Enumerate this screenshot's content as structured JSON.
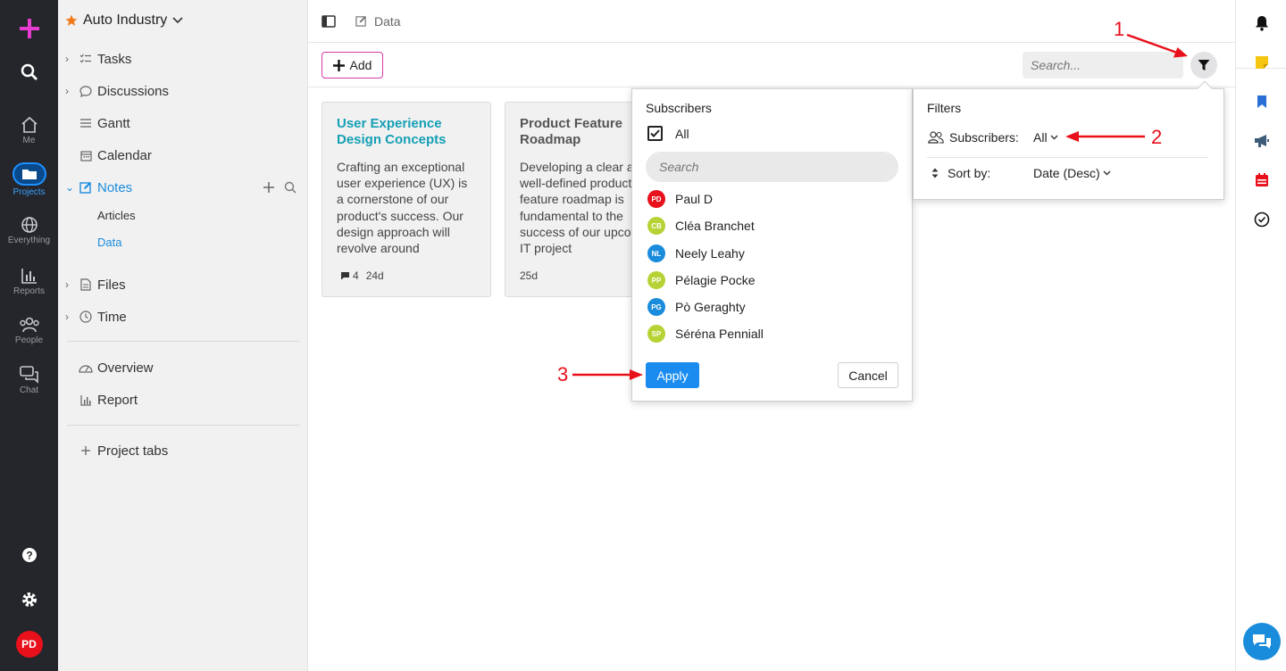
{
  "rail": {
    "items": [
      {
        "label": "Me"
      },
      {
        "label": "Projects"
      },
      {
        "label": "Everything"
      },
      {
        "label": "Reports"
      },
      {
        "label": "People"
      },
      {
        "label": "Chat"
      }
    ],
    "avatar_initials": "PD"
  },
  "sidebar": {
    "project_name": "Auto Industry",
    "items": [
      {
        "label": "Tasks"
      },
      {
        "label": "Discussions"
      },
      {
        "label": "Gantt"
      },
      {
        "label": "Calendar"
      },
      {
        "label": "Notes"
      },
      {
        "label": "Articles"
      },
      {
        "label": "Data"
      },
      {
        "label": "Files"
      },
      {
        "label": "Time"
      },
      {
        "label": "Overview"
      },
      {
        "label": "Report"
      },
      {
        "label": "Project tabs"
      }
    ]
  },
  "topbar": {
    "breadcrumb": "Data"
  },
  "toolbar": {
    "add_label": "Add",
    "search_placeholder": "Search..."
  },
  "cards": [
    {
      "title": "User Experience Design Concepts",
      "excerpt": "Crafting an exceptional user experience (UX) is a cornerstone of our product's success. Our design approach will revolve around",
      "comments": "4",
      "age": "24d"
    },
    {
      "title": "Product Feature Roadmap",
      "excerpt": "Developing a clear and well-defined product feature roadmap is fundamental to the success of our upcoming IT project",
      "age": "25d"
    }
  ],
  "subscribers_popup": {
    "title": "Subscribers",
    "all_label": "All",
    "search_placeholder": "Search",
    "users": [
      {
        "initials": "PD",
        "name": "Paul D",
        "color": "#e8101a"
      },
      {
        "initials": "CB",
        "name": "Cléa Branchet",
        "color": "#b5d334"
      },
      {
        "initials": "NL",
        "name": "Neely Leahy",
        "color": "#1a8cdc"
      },
      {
        "initials": "PP",
        "name": "Pélagie Pocke",
        "color": "#b5d334"
      },
      {
        "initials": "PG",
        "name": "Pò Geraghty",
        "color": "#1a8cdc"
      },
      {
        "initials": "SP",
        "name": "Séréna Penniall",
        "color": "#b5d334"
      }
    ],
    "apply_label": "Apply",
    "cancel_label": "Cancel"
  },
  "filters_popup": {
    "title": "Filters",
    "subscribers_label": "Subscribers:",
    "subscribers_value": "All",
    "sort_label": "Sort by:",
    "sort_value": "Date (Desc)"
  },
  "annotations": [
    "1",
    "2",
    "3"
  ],
  "colors": {
    "accent": "#1a8cdc",
    "annotation": "#e8101a",
    "add_border": "#d63aa8"
  }
}
